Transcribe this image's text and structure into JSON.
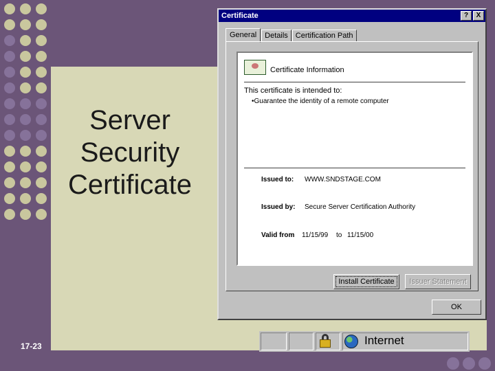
{
  "slide": {
    "title": "Server\nSecurity\nCertificate",
    "slide_number": "17-23"
  },
  "dialog": {
    "title": "Certificate",
    "help_button": "?",
    "close_button": "X",
    "tabs": [
      {
        "label": "General",
        "active": true
      },
      {
        "label": "Details",
        "active": false
      },
      {
        "label": "Certification Path",
        "active": false
      }
    ],
    "general": {
      "heading": "Certificate Information",
      "intended_label": "This certificate is intended to:",
      "purposes": [
        "•Guarantee the identity of a remote computer"
      ],
      "issued_to_label": "Issued to:",
      "issued_to": "WWW.SNDSTAGE.COM",
      "issued_by_label": "Issued by:",
      "issued_by": "Secure Server Certification Authority",
      "valid_from_label": "Valid from",
      "valid_from": "11/15/99",
      "valid_to_label": "to",
      "valid_to": "11/15/00"
    },
    "buttons": {
      "install": "Install Certificate",
      "issuer_statement": "Issuer Statement",
      "ok": "OK"
    }
  },
  "statusbar": {
    "zone": "Internet"
  },
  "colors": {
    "slide_purple": "#6b5578",
    "slide_beige": "#d8d8b6",
    "titlebar": "#000080",
    "window": "#c0c0c0"
  }
}
